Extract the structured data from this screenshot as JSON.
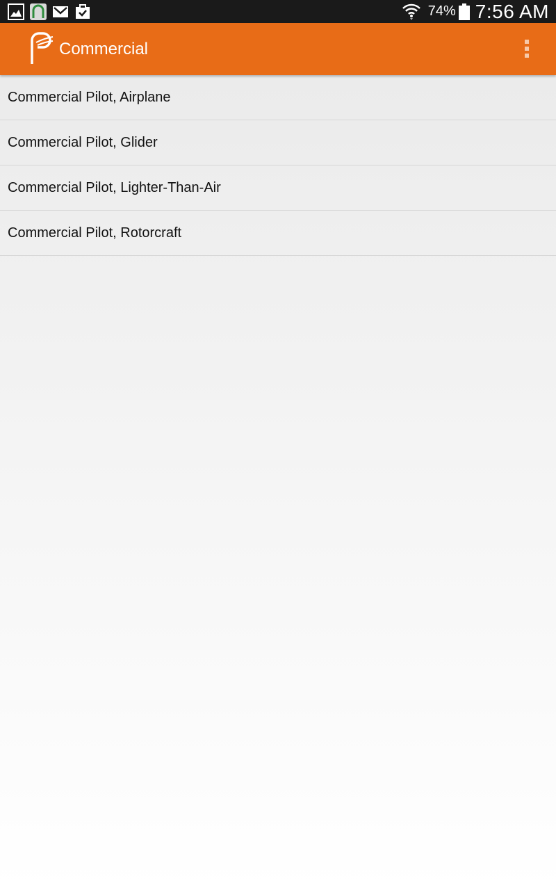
{
  "status_bar": {
    "icons": [
      "gallery-icon",
      "app-notification-icon",
      "gmail-icon",
      "clipboard-check-icon"
    ],
    "battery_percent": "74%",
    "time": "7:56 AM"
  },
  "app_bar": {
    "title": "Commercial",
    "color": "#e86c17"
  },
  "list": {
    "items": [
      {
        "label": "Commercial Pilot, Airplane"
      },
      {
        "label": "Commercial Pilot, Glider"
      },
      {
        "label": "Commercial Pilot, Lighter-Than-Air"
      },
      {
        "label": "Commercial Pilot, Rotorcraft"
      }
    ]
  }
}
